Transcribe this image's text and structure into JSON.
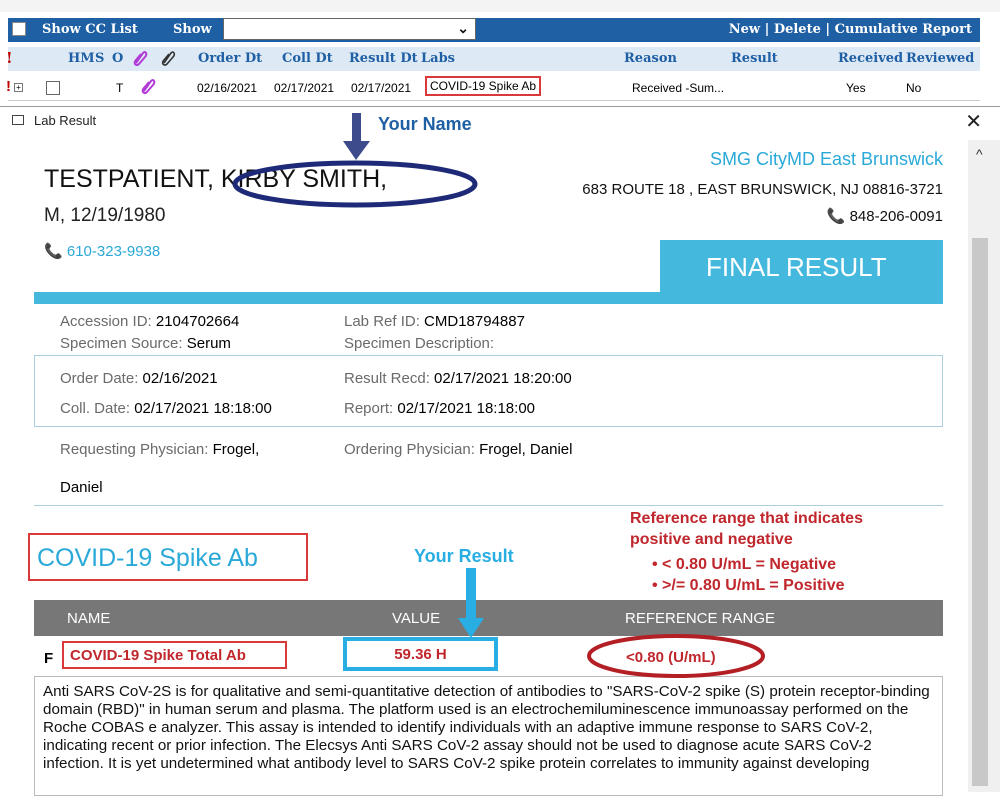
{
  "app": {
    "toolbar": {
      "show_cc_list": "Show CC List",
      "show_label": "Show",
      "actions": [
        "New",
        "Delete",
        "Cumulative Report"
      ]
    },
    "columns": [
      "HM",
      "S",
      "O",
      "Order Dt",
      "Coll Dt",
      "Result Dt",
      "Labs",
      "Reason",
      "Result",
      "Received",
      "Reviewed"
    ],
    "row": {
      "o": "T",
      "order_dt": "02/16/2021",
      "coll_dt": "02/17/2021",
      "result_dt": "02/17/2021",
      "labs": "COVID-19 Spike Ab",
      "reason": "Received -Sum...",
      "received": "Yes",
      "reviewed": "No"
    }
  },
  "dialog": {
    "title": "Lab Result",
    "patient": {
      "name": "TESTPATIENT, KIRBY SMITH,",
      "sex_dob": "M, 12/19/1980",
      "phone": "610-323-9938"
    },
    "clinic": {
      "name": "SMG CityMD East Brunswick",
      "address": "683 ROUTE 18 , EAST BRUNSWICK, NJ 08816-3721",
      "phone": "848-206-0091"
    },
    "status": "FINAL RESULT",
    "details": {
      "accession_label": "Accession ID:",
      "accession": "2104702664",
      "labref_label": "Lab Ref ID:",
      "labref": "CMD18794887",
      "source_label": "Specimen Source:",
      "source": "Serum",
      "desc_label": "Specimen Description:",
      "order_label": "Order Date:",
      "order_date": "02/16/2021",
      "recd_label": "Result Recd:",
      "recd": "02/17/2021 18:20:00",
      "coll_label": "Coll. Date:",
      "coll": "02/17/2021 18:18:00",
      "report_label": "Report:",
      "report": "02/17/2021  18:18:00",
      "req_label": "Requesting Physician:",
      "req": "Frogel,",
      "req2": "Daniel",
      "ord_label": "Ordering Physician:",
      "ord": "Frogel, Daniel"
    },
    "test_title": "COVID-19 Spike Ab",
    "table": {
      "headers": [
        "NAME",
        "VALUE",
        "REFERENCE RANGE"
      ],
      "flag": "F",
      "name": "COVID-19 Spike Total Ab",
      "value": "59.36 H",
      "range": "<0.80 (U/mL)"
    },
    "notes": "Anti SARS CoV-2S is for qualitative and semi-quantitative detection of antibodies to \"SARS-CoV-2 spike (S) protein receptor-binding domain (RBD)\" in human serum and plasma. The platform used is an electrochemiluminescence immunoassay performed on the Roche COBAS e analyzer. This assay is intended to identify individuals with an adaptive immune response to SARS CoV-2, indicating recent or prior infection. The Elecsys Anti SARS CoV-2 assay should not be used to diagnose acute SARS CoV-2 infection. It is yet undetermined what antibody level to SARS CoV-2 spike protein correlates to immunity against developing"
  },
  "annotations": {
    "your_name": "Your Name",
    "your_result": "Your Result",
    "ref_title_1": "Reference range that indicates",
    "ref_title_2": "positive and negative",
    "ref_neg": "• < 0.80 U/mL = Negative",
    "ref_pos": "• >/= 0.80 U/mL = Positive"
  },
  "colors": {
    "accent": "#45b8dd",
    "annotation_blue": "#1f5fa4",
    "annotation_red": "#c0272d",
    "navy_ellipse": "#1e2a78"
  }
}
